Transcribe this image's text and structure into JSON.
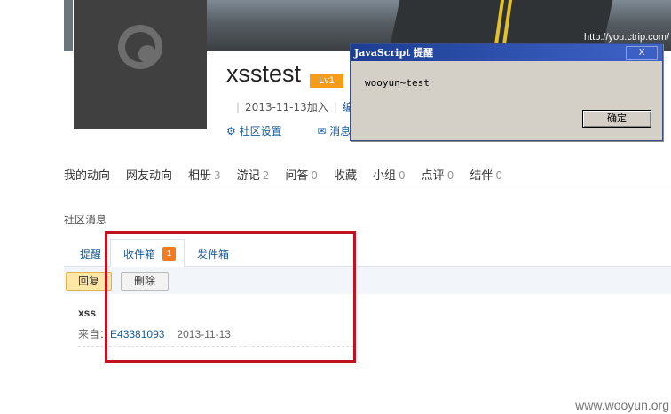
{
  "banner": {
    "url_text": "http://you.ctrip.com/"
  },
  "profile": {
    "username": "xsstest",
    "level": "Lv1",
    "joined": "2013-11-13加入",
    "joined_more": "编",
    "community_settings": "社区设置",
    "messages": "消息"
  },
  "dialog": {
    "title": "JavaScript 提醒",
    "close_label": "X",
    "message": "wooyun~test",
    "ok_label": "确定"
  },
  "nav": {
    "items": [
      {
        "label": "我的动向",
        "count": ""
      },
      {
        "label": "网友动向",
        "count": ""
      },
      {
        "label": "相册",
        "count": "3"
      },
      {
        "label": "游记",
        "count": "2"
      },
      {
        "label": "问答",
        "count": "0"
      },
      {
        "label": "收藏",
        "count": ""
      },
      {
        "label": "小组",
        "count": "0"
      },
      {
        "label": "点评",
        "count": "0"
      },
      {
        "label": "结伴",
        "count": "0"
      }
    ]
  },
  "section": {
    "title": "社区消息"
  },
  "subtabs": {
    "remind": "提醒",
    "inbox": "收件箱",
    "inbox_badge": "1",
    "outbox": "发件箱"
  },
  "toolbar": {
    "reply": "回复",
    "delete": "删除"
  },
  "message": {
    "subject": "xss",
    "from_label": "来自：",
    "sender": "E43381093",
    "date": "2013-11-13"
  },
  "watermark": "www.wooyun.org",
  "colors": {
    "accent": "#1a5a9a",
    "highlight": "#c1121f",
    "badge": "#f47b20"
  }
}
